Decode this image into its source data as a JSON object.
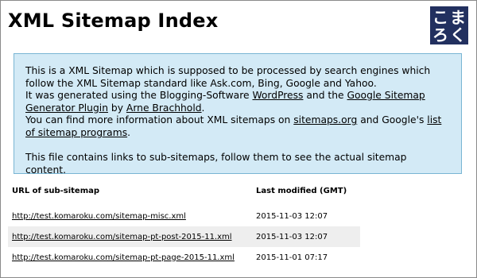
{
  "header": {
    "title": "XML Sitemap Index",
    "logo": {
      "text": "こまろく",
      "chars": [
        "こ",
        "ま",
        "ろ",
        "く"
      ],
      "background_color": "#22305f",
      "text_color": "#ffffff"
    }
  },
  "intro": {
    "p1": {
      "line1": "This is a XML Sitemap which is supposed to be processed by search engines which follow the XML Sitemap standard like Ask.com, Bing, Google and Yahoo.",
      "line2_prefix": "It was generated using the Blogging-Software ",
      "wordpress_link": "WordPress",
      "line2_middle": " and the ",
      "plugin_link": "Google Sitemap Generator Plugin",
      "line2_by": " by ",
      "author_link": "Arne Brachhold",
      "line2_end": ".",
      "line3_prefix": "You can find more information about XML sitemaps on ",
      "sitemaps_link": "sitemaps.org",
      "line3_middle": " and Google's ",
      "programs_link": "list of sitemap programs",
      "line3_end": "."
    },
    "p2": "This file contains links to sub-sitemaps, follow them to see the actual sitemap content.",
    "background_color": "#d3eaf6",
    "border_color": "#79b5d3"
  },
  "table": {
    "headers": {
      "url": "URL of sub-sitemap",
      "modified": "Last modified (GMT)"
    },
    "rows": [
      {
        "url": "http://test.komaroku.com/sitemap-misc.xml",
        "modified": "2015-11-03 12:07"
      },
      {
        "url": "http://test.komaroku.com/sitemap-pt-post-2015-11.xml",
        "modified": "2015-11-03 12:07"
      },
      {
        "url": "http://test.komaroku.com/sitemap-pt-page-2015-11.xml",
        "modified": "2015-11-01 07:17"
      }
    ],
    "alt_row_color": "#eeeeee"
  }
}
